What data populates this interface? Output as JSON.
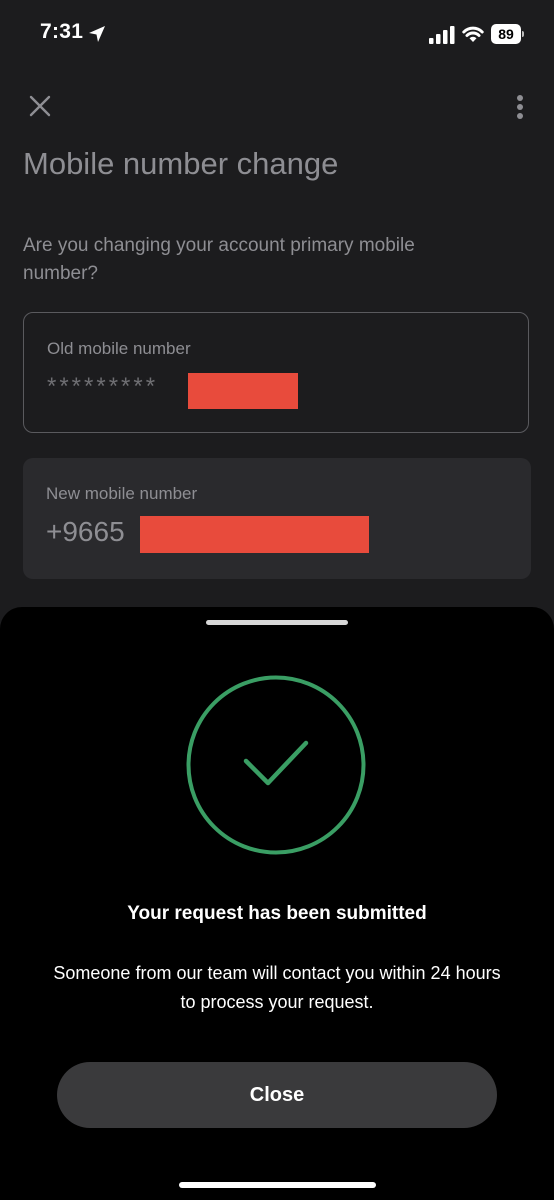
{
  "status_bar": {
    "time": "7:31",
    "battery": "89",
    "icons": [
      "location-arrow-icon",
      "signal-icon",
      "wifi-icon",
      "battery-icon"
    ]
  },
  "header": {
    "close_icon": "close-icon",
    "more_icon": "more-vertical-icon",
    "title": "Mobile number change"
  },
  "form": {
    "question": "Are you changing your account primary mobile number?",
    "old_number": {
      "label": "Old mobile number",
      "value": "*********"
    },
    "new_number": {
      "label": "New mobile number",
      "value": "+9665"
    }
  },
  "sheet": {
    "icon": "check-circle-icon",
    "title": "Your request has been submitted",
    "description": "Someone from our team will contact you within 24 hours to process your request.",
    "close_label": "Close"
  },
  "colors": {
    "background": "#1c1c1e",
    "sheet_background": "#000000",
    "success_green": "#3a9e64",
    "redaction": "#e84b3c",
    "button": "#3a3a3c"
  }
}
